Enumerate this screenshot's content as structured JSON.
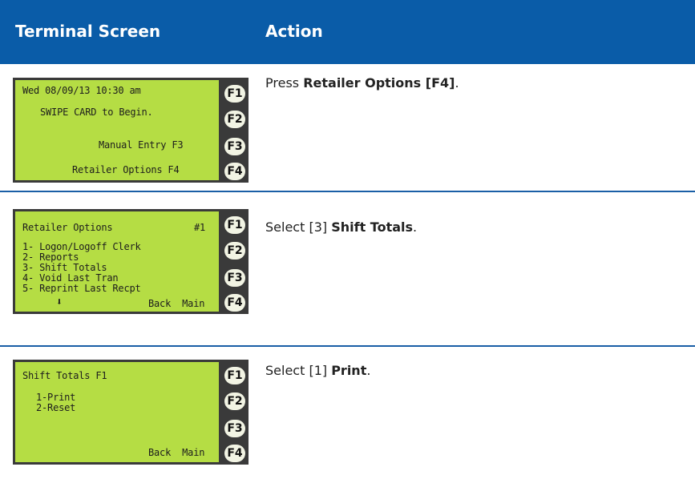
{
  "header": {
    "col_screen": "Terminal Screen",
    "col_action": "Action"
  },
  "fkeys": [
    "F1",
    "F2",
    "F3",
    "F4"
  ],
  "rows": [
    {
      "screen_lines": [
        "Wed 08/09/13 10:30 am",
        "SWIPE CARD to Begin.",
        "Manual Entry F3",
        "Retailer Options F4"
      ],
      "action_prefix": "Press ",
      "action_bold": "Retailer Options [F4]",
      "action_suffix": "."
    },
    {
      "screen_title": "Retailer Options",
      "screen_title_right": "#1",
      "screen_lines": [
        "1- Logon/Logoff Clerk",
        "2- Reports",
        "3- Shift Totals",
        "4- Void Last Tran",
        "5- Reprint Last Recpt"
      ],
      "down_arrow": "⬇",
      "nav": "Back  Main",
      "action_prefix": "Select [3] ",
      "action_bold": "Shift Totals",
      "action_suffix": "."
    },
    {
      "screen_title": "Shift Totals F1",
      "screen_lines": [
        "1-Print",
        "2-Reset"
      ],
      "nav": "Back  Main",
      "action_prefix": "Select [1] ",
      "action_bold": "Print",
      "action_suffix": "."
    }
  ],
  "colors": {
    "header_bg": "#0a5ca8",
    "lcd_bg": "#b5dd44",
    "panel_bg": "#3a3a3a",
    "separator": "#1a5fa6"
  }
}
